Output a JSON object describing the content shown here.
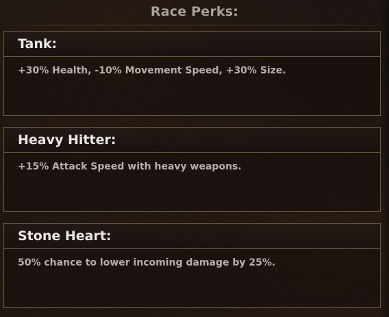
{
  "panel": {
    "title": "Race Perks:"
  },
  "perks": [
    {
      "name": "Tank:",
      "description": "+30% Health, -10% Movement Speed, +30% Size."
    },
    {
      "name": "Heavy Hitter:",
      "description": "+15% Attack Speed with heavy weapons."
    },
    {
      "name": "Stone Heart:",
      "description": "50% chance to lower incoming damage by 25%."
    }
  ],
  "colors": {
    "background": "#1c1511",
    "border": "#6b5a49",
    "title_text": "#a8a29a",
    "perk_name_text": "#ece8e3",
    "perk_desc_text": "#b6b1aa"
  }
}
